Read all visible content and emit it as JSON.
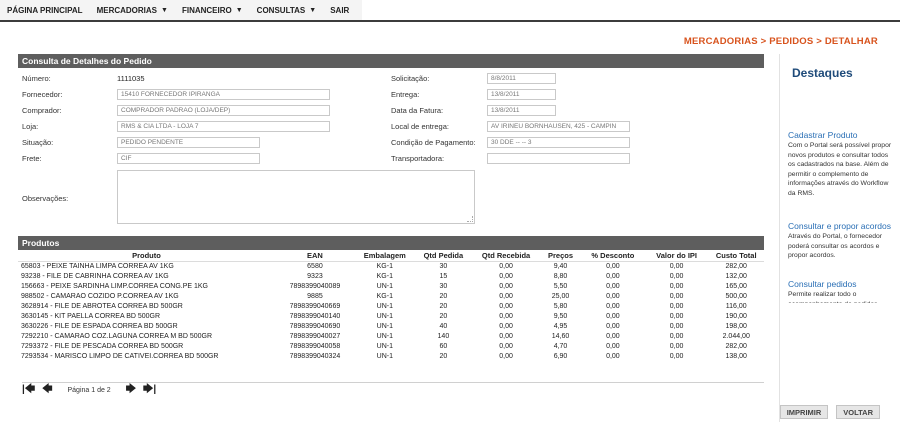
{
  "menu": [
    {
      "label": "PÁGINA PRINCIPAL",
      "dropdown": false
    },
    {
      "label": "MERCADORIAS",
      "dropdown": true
    },
    {
      "label": "FINANCEIRO",
      "dropdown": true
    },
    {
      "label": "CONSULTAS",
      "dropdown": true
    },
    {
      "label": "SAIR",
      "dropdown": false
    }
  ],
  "breadcrumb": "MERCADORIAS > PEDIDOS > DETALHAR",
  "details": {
    "header": "Consulta de Detalhes do Pedido",
    "numero_label": "Número:",
    "numero_value": "1111035",
    "fornecedor_label": "Fornecedor:",
    "fornecedor_value": "15410 FORNECEDOR IPIRANGA",
    "comprador_label": "Comprador:",
    "comprador_value": "COMPRADOR PADRAO (LOJA/DEP)",
    "loja_label": "Loja:",
    "loja_value": "RMS & CIA LTDA - LOJA 7",
    "situacao_label": "Situação:",
    "situacao_value": "PEDIDO PENDENTE",
    "frete_label": "Frete:",
    "frete_value": "CIF",
    "observacoes_label": "Observações:",
    "solicitacao_label": "Solicitação:",
    "solicitacao_value": "8/8/2011",
    "entrega_label": "Entrega:",
    "entrega_value": "13/8/2011",
    "data_fatura_label": "Data da Fatura:",
    "data_fatura_value": "13/8/2011",
    "local_entrega_label": "Local de entrega:",
    "local_entrega_value": "AV IRINEU BORNHAUSEN, 425 - CAMPIN",
    "condicao_label": "Condição de Pagamento:",
    "condicao_value": "30 DDE -- -- 3",
    "transportadora_label": "Transportadora:",
    "transportadora_value": ""
  },
  "products": {
    "header": "Produtos",
    "columns": [
      "Produto",
      "EAN",
      "Embalagem",
      "Qtd Pedida",
      "Qtd Recebida",
      "Preços",
      "% Desconto",
      "Valor do IPI",
      "Custo Total"
    ],
    "rows": [
      [
        "65803 - PEIXE TAINHA LIMPA CORREA AV 1KG",
        "6580",
        "KG-1",
        "30",
        "0,00",
        "9,40",
        "0,00",
        "0,00",
        "282,00"
      ],
      [
        "93238 - FILE DE CABRINHA CORREA AV 1KG",
        "9323",
        "KG-1",
        "15",
        "0,00",
        "8,80",
        "0,00",
        "0,00",
        "132,00"
      ],
      [
        "156663 - PEIXE SARDINHA LIMP.CORREA CONG.PE 1KG",
        "7898399040089",
        "UN-1",
        "30",
        "0,00",
        "5,50",
        "0,00",
        "0,00",
        "165,00"
      ],
      [
        "988502 - CAMARAO COZIDO P.CORREA AV 1KG",
        "9885",
        "KG-1",
        "20",
        "0,00",
        "25,00",
        "0,00",
        "0,00",
        "500,00"
      ],
      [
        "3628914 - FILE DE ABROTEA CORREA BD 500GR",
        "7898399040669",
        "UN-1",
        "20",
        "0,00",
        "5,80",
        "0,00",
        "0,00",
        "116,00"
      ],
      [
        "3630145 - KIT PAELLA CORREA BD 500GR",
        "7898399040140",
        "UN-1",
        "20",
        "0,00",
        "9,50",
        "0,00",
        "0,00",
        "190,00"
      ],
      [
        "3630226 - FILE DE ESPADA CORREA BD 500GR",
        "7898399040690",
        "UN-1",
        "40",
        "0,00",
        "4,95",
        "0,00",
        "0,00",
        "198,00"
      ],
      [
        "7292210 - CAMARAO COZ.LAGUNA CORREA M BD 500GR",
        "7898399040027",
        "UN-1",
        "140",
        "0,00",
        "14,60",
        "0,00",
        "0,00",
        "2.044,00"
      ],
      [
        "7293372 - FILE DE PESCADA CORREA BD 500GR",
        "7898399040058",
        "UN-1",
        "60",
        "0,00",
        "4,70",
        "0,00",
        "0,00",
        "282,00"
      ],
      [
        "7293534 - MARISCO LIMPO DE CATIVEI.CORREA BD 500GR",
        "7898399040324",
        "UN-1",
        "20",
        "0,00",
        "6,90",
        "0,00",
        "0,00",
        "138,00"
      ]
    ]
  },
  "pager": {
    "first_icon": "first-page-icon",
    "prev_icon": "previous-page-icon",
    "page_text": "Página 1 de 2",
    "next_icon": "next-page-icon",
    "last_icon": "last-page-icon"
  },
  "buttons": {
    "print": "IMPRIMIR",
    "back": "VOLTAR"
  },
  "sidebar": {
    "title": "Destaques",
    "items": [
      {
        "link": "Cadastrar Produto",
        "text": "Com o Portal será possível propor novos produtos e consultar todos os cadastrados na base. Além de permitir o complemento de informações através do Workflow da RMS."
      },
      {
        "link": "Consultar e propor acordos",
        "text": "Através do Portal, o fornecedor poderá consultar os acordos e propor acordos."
      },
      {
        "link": "Consultar pedidos",
        "text": "Permite realizar todo o acompanhamento de pedidos"
      }
    ]
  },
  "colors": {
    "breadcrumb": "#d8531d",
    "panel_header": "#5e5e5e",
    "sidebar_title": "#1f4b7a",
    "sidebar_link": "#2a6fb5"
  }
}
